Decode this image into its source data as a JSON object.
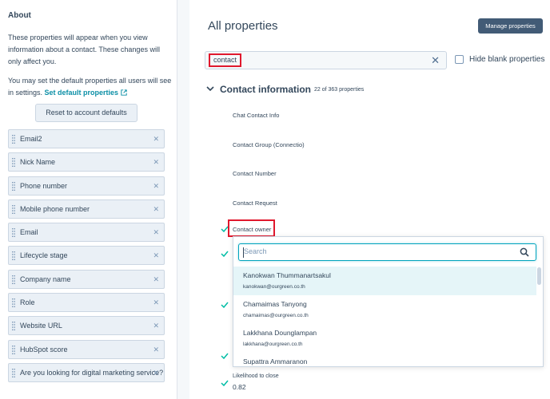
{
  "about": {
    "title": "About",
    "para1": "These properties will appear when you view information about a contact. These changes will only affect you.",
    "para2_text": "You may set the default properties all users will see in settings.",
    "para2_link": "Set default properties",
    "reset_button": "Reset to account defaults"
  },
  "properties": [
    {
      "label": "Email2"
    },
    {
      "label": "Nick Name"
    },
    {
      "label": "Phone number"
    },
    {
      "label": "Mobile phone number"
    },
    {
      "label": "Email"
    },
    {
      "label": "Lifecycle stage"
    },
    {
      "label": "Company name"
    },
    {
      "label": "Role"
    },
    {
      "label": "Website URL"
    },
    {
      "label": "HubSpot score"
    },
    {
      "label": "Are you looking for digital marketing service?"
    }
  ],
  "main": {
    "title": "All properties",
    "manage_button": "Manage properties",
    "search_value": "contact",
    "hide_blank_label": "Hide blank properties",
    "section_title": "Contact information",
    "section_count": "22 of 363 properties",
    "fields": [
      {
        "label": "Chat Contact Info"
      },
      {
        "label": "Contact Group (Connectio)"
      },
      {
        "label": "Contact Number"
      },
      {
        "label": "Contact Request"
      },
      {
        "label": "Contact owner"
      }
    ],
    "likelihood_label": "Likelihood to close",
    "likelihood_value": "0.82"
  },
  "dropdown": {
    "search_placeholder": "Search",
    "options": [
      {
        "name": "Kanokwan Thummanartsakul",
        "email": "kanokwan@ourgreen.co.th"
      },
      {
        "name": "Chamaimas Tanyong",
        "email": "chamaimas@ourgreen.co.th"
      },
      {
        "name": "Lakkhana Dounglampan",
        "email": "lakkhana@ourgreen.co.th"
      },
      {
        "name": "Supattra Ammaranon",
        "email": ""
      }
    ]
  },
  "colors": {
    "accent": "#0b8fa6",
    "highlight_border": "#e0182d",
    "check": "#00bda5",
    "manage_button_bg": "#425b76"
  }
}
